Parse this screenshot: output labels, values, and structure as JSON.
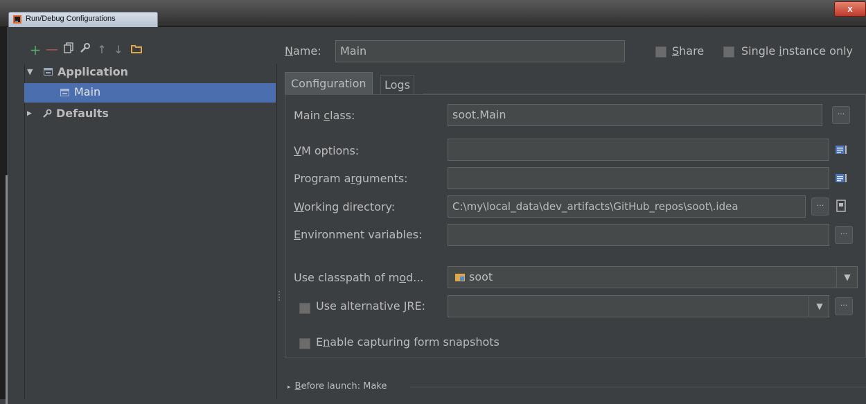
{
  "window": {
    "title": "Run/Debug Configurations",
    "close_label": "x"
  },
  "toolbar": {
    "add": "+",
    "remove": "—",
    "copy": "⧉",
    "edit_defaults": "🔧",
    "move_up": "↑",
    "move_down": "↓",
    "folder": "📁"
  },
  "tree": {
    "application": "Application",
    "main": "Main",
    "defaults": "Defaults"
  },
  "name_row": {
    "label_prefix": "",
    "label_mnemonic": "N",
    "label_rest": "ame:",
    "value": "Main",
    "share_mnemonic": "S",
    "share_rest": "hare",
    "single_prefix": "Single ",
    "single_mnemonic": "i",
    "single_rest": "nstance only"
  },
  "tabs": {
    "configuration": "Configuration",
    "logs": "Logs"
  },
  "form": {
    "main_class_prefix": "Main ",
    "main_class_mnemonic": "c",
    "main_class_rest": "lass:",
    "main_class_value": "soot.Main",
    "vm_mnemonic": "V",
    "vm_rest": "M options:",
    "vm_value": "",
    "prog_prefix": "Program a",
    "prog_mnemonic": "r",
    "prog_rest": "guments:",
    "prog_value": "",
    "wd_mnemonic": "W",
    "wd_rest": "orking directory:",
    "wd_value": "C:\\my\\local_data\\dev_artifacts\\GitHub_repos\\soot\\.idea",
    "env_mnemonic": "E",
    "env_rest": "nvironment variables:",
    "env_value": "",
    "classpath_prefix": "Use classpath of m",
    "classpath_mnemonic": "o",
    "classpath_rest": "d...",
    "classpath_value": "soot",
    "alt_jre_prefix": "Use alternative ",
    "alt_jre_mnemonic": "J",
    "alt_jre_rest": "RE:",
    "alt_jre_value": "",
    "snapshots_prefix": "E",
    "snapshots_mnemonic": "n",
    "snapshots_rest": "able capturing form snapshots",
    "ellipsis": "···"
  },
  "before_launch": {
    "arrow": "▸",
    "mnemonic": "B",
    "rest": "efore launch: Make"
  },
  "colors": {
    "background": "#3c3f41",
    "selection": "#4b6eaf",
    "field": "#45494a",
    "add_green": "#59a869",
    "remove_red": "#c75450",
    "folder_orange": "#e0a74a"
  },
  "icons": {
    "expanded": "▼",
    "collapsed": "▶",
    "dropdown": "▼"
  }
}
